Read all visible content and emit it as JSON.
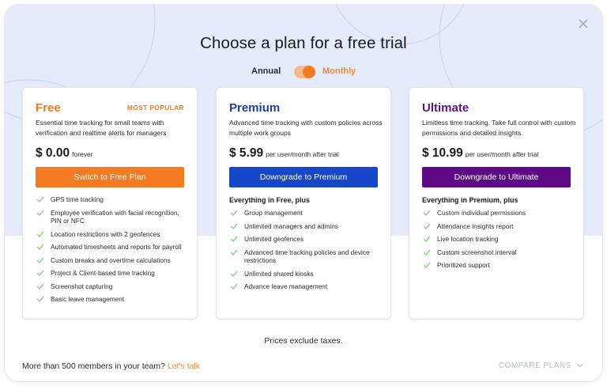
{
  "title": "Choose a plan for a free trial",
  "billing_toggle": {
    "annual_label": "Annual",
    "monthly_label": "Monthly",
    "selected": "Monthly"
  },
  "plans": [
    {
      "name": "Free",
      "badge": "MOST POPULAR",
      "description": "Essential time tracking for small teams with verification and realtime alerts for managers",
      "price": "$ 0.00",
      "price_suffix": "forever",
      "button_label": "Switch to Free Plan",
      "features_title": "",
      "features": [
        "GPS time tracking",
        "Employee verification with facial recognition, PIN or NFC",
        "Location restrictions with 2 geofences",
        "Automated timesheets and reports for payroll",
        "Custom breaks and overtime calculations",
        "Project & Client-based time tracking",
        "Screenshot capturing",
        "Basic leave management"
      ]
    },
    {
      "name": "Premium",
      "badge": "",
      "description": "Advanced time tracking with custom policies across multiple work groups",
      "price": "$ 5.99",
      "price_suffix": "per user/month after trial",
      "button_label": "Downgrade to Premium",
      "features_title": "Everything in Free, plus",
      "features": [
        "Group management",
        "Unlimited managers and admins",
        "Unlimited geofences",
        "Advanced time tracking policies and device restrictions",
        "Unlimited shared kiosks",
        "Advance leave management"
      ]
    },
    {
      "name": "Ultimate",
      "badge": "",
      "description": "Limitless time tracking. Take full control with custom permissions and detailed insights",
      "price": "$ 10.99",
      "price_suffix": "per user/month after trial",
      "button_label": "Downgrade to Ultimate",
      "features_title": "Everything in Premium, plus",
      "features": [
        "Custom individual permissions",
        "Attendance insights report",
        "Live location tracking",
        "Custom screenshot interval",
        "Prioritized support"
      ]
    }
  ],
  "footnote": "Prices exclude taxes.",
  "bottom": {
    "team_text": "More than 500 members in your team?",
    "talk_link": "Let's talk",
    "compare_label": "COMPARE PLANS"
  },
  "colors": {
    "accent_orange": "#f57b22",
    "free_title": "#f07a21",
    "premium": "#1747c9",
    "premium_title": "#1d3f9e",
    "ultimate": "#5e0a87",
    "ultimate_title": "#5a1585",
    "check": "#7bc47f",
    "hero_background": "#e5ebfb"
  },
  "icons": {
    "close": "close-icon",
    "check": "check-icon",
    "chevron": "chevron-down-icon"
  }
}
